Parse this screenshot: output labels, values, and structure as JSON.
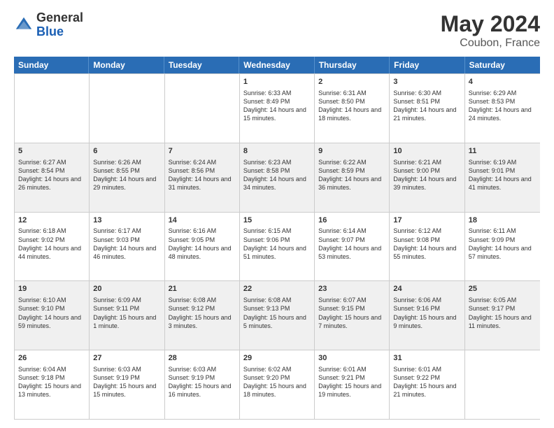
{
  "header": {
    "logo": {
      "general": "General",
      "blue": "Blue"
    },
    "title": "May 2024",
    "location": "Coubon, France"
  },
  "weekdays": [
    "Sunday",
    "Monday",
    "Tuesday",
    "Wednesday",
    "Thursday",
    "Friday",
    "Saturday"
  ],
  "weeks": [
    [
      {
        "day": "",
        "info": ""
      },
      {
        "day": "",
        "info": ""
      },
      {
        "day": "",
        "info": ""
      },
      {
        "day": "1",
        "info": "Sunrise: 6:33 AM\nSunset: 8:49 PM\nDaylight: 14 hours and 15 minutes."
      },
      {
        "day": "2",
        "info": "Sunrise: 6:31 AM\nSunset: 8:50 PM\nDaylight: 14 hours and 18 minutes."
      },
      {
        "day": "3",
        "info": "Sunrise: 6:30 AM\nSunset: 8:51 PM\nDaylight: 14 hours and 21 minutes."
      },
      {
        "day": "4",
        "info": "Sunrise: 6:29 AM\nSunset: 8:53 PM\nDaylight: 14 hours and 24 minutes."
      }
    ],
    [
      {
        "day": "5",
        "info": "Sunrise: 6:27 AM\nSunset: 8:54 PM\nDaylight: 14 hours and 26 minutes."
      },
      {
        "day": "6",
        "info": "Sunrise: 6:26 AM\nSunset: 8:55 PM\nDaylight: 14 hours and 29 minutes."
      },
      {
        "day": "7",
        "info": "Sunrise: 6:24 AM\nSunset: 8:56 PM\nDaylight: 14 hours and 31 minutes."
      },
      {
        "day": "8",
        "info": "Sunrise: 6:23 AM\nSunset: 8:58 PM\nDaylight: 14 hours and 34 minutes."
      },
      {
        "day": "9",
        "info": "Sunrise: 6:22 AM\nSunset: 8:59 PM\nDaylight: 14 hours and 36 minutes."
      },
      {
        "day": "10",
        "info": "Sunrise: 6:21 AM\nSunset: 9:00 PM\nDaylight: 14 hours and 39 minutes."
      },
      {
        "day": "11",
        "info": "Sunrise: 6:19 AM\nSunset: 9:01 PM\nDaylight: 14 hours and 41 minutes."
      }
    ],
    [
      {
        "day": "12",
        "info": "Sunrise: 6:18 AM\nSunset: 9:02 PM\nDaylight: 14 hours and 44 minutes."
      },
      {
        "day": "13",
        "info": "Sunrise: 6:17 AM\nSunset: 9:03 PM\nDaylight: 14 hours and 46 minutes."
      },
      {
        "day": "14",
        "info": "Sunrise: 6:16 AM\nSunset: 9:05 PM\nDaylight: 14 hours and 48 minutes."
      },
      {
        "day": "15",
        "info": "Sunrise: 6:15 AM\nSunset: 9:06 PM\nDaylight: 14 hours and 51 minutes."
      },
      {
        "day": "16",
        "info": "Sunrise: 6:14 AM\nSunset: 9:07 PM\nDaylight: 14 hours and 53 minutes."
      },
      {
        "day": "17",
        "info": "Sunrise: 6:12 AM\nSunset: 9:08 PM\nDaylight: 14 hours and 55 minutes."
      },
      {
        "day": "18",
        "info": "Sunrise: 6:11 AM\nSunset: 9:09 PM\nDaylight: 14 hours and 57 minutes."
      }
    ],
    [
      {
        "day": "19",
        "info": "Sunrise: 6:10 AM\nSunset: 9:10 PM\nDaylight: 14 hours and 59 minutes."
      },
      {
        "day": "20",
        "info": "Sunrise: 6:09 AM\nSunset: 9:11 PM\nDaylight: 15 hours and 1 minute."
      },
      {
        "day": "21",
        "info": "Sunrise: 6:08 AM\nSunset: 9:12 PM\nDaylight: 15 hours and 3 minutes."
      },
      {
        "day": "22",
        "info": "Sunrise: 6:08 AM\nSunset: 9:13 PM\nDaylight: 15 hours and 5 minutes."
      },
      {
        "day": "23",
        "info": "Sunrise: 6:07 AM\nSunset: 9:15 PM\nDaylight: 15 hours and 7 minutes."
      },
      {
        "day": "24",
        "info": "Sunrise: 6:06 AM\nSunset: 9:16 PM\nDaylight: 15 hours and 9 minutes."
      },
      {
        "day": "25",
        "info": "Sunrise: 6:05 AM\nSunset: 9:17 PM\nDaylight: 15 hours and 11 minutes."
      }
    ],
    [
      {
        "day": "26",
        "info": "Sunrise: 6:04 AM\nSunset: 9:18 PM\nDaylight: 15 hours and 13 minutes."
      },
      {
        "day": "27",
        "info": "Sunrise: 6:03 AM\nSunset: 9:19 PM\nDaylight: 15 hours and 15 minutes."
      },
      {
        "day": "28",
        "info": "Sunrise: 6:03 AM\nSunset: 9:19 PM\nDaylight: 15 hours and 16 minutes."
      },
      {
        "day": "29",
        "info": "Sunrise: 6:02 AM\nSunset: 9:20 PM\nDaylight: 15 hours and 18 minutes."
      },
      {
        "day": "30",
        "info": "Sunrise: 6:01 AM\nSunset: 9:21 PM\nDaylight: 15 hours and 19 minutes."
      },
      {
        "day": "31",
        "info": "Sunrise: 6:01 AM\nSunset: 9:22 PM\nDaylight: 15 hours and 21 minutes."
      },
      {
        "day": "",
        "info": ""
      }
    ]
  ]
}
